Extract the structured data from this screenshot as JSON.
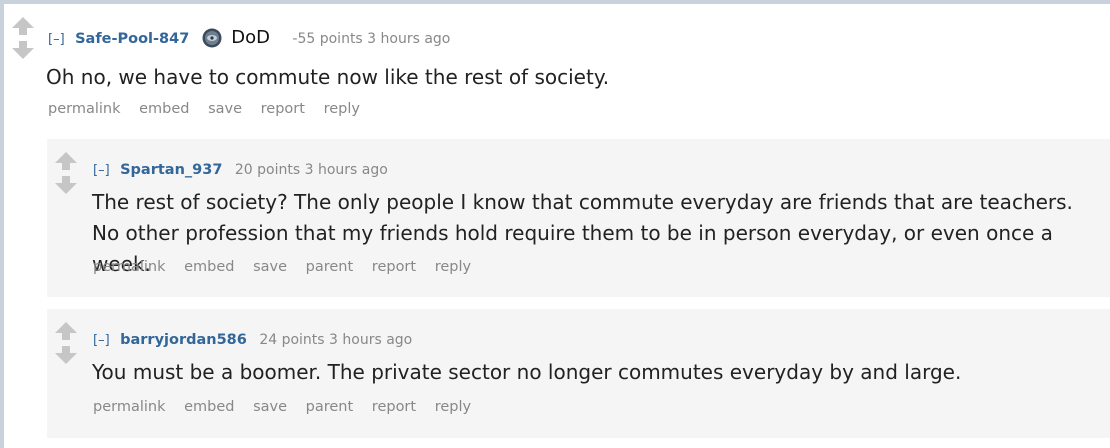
{
  "comments": [
    {
      "toggle": "[–]",
      "author": "Safe-Pool-847",
      "flair_icon": "dod-seal-icon",
      "flair": "DoD",
      "score_time": "-55 points 3 hours ago",
      "body": "Oh no, we have to commute now like the rest of society.",
      "actions": [
        "permalink",
        "embed",
        "save",
        "report",
        "reply"
      ]
    },
    {
      "toggle": "[–]",
      "author": "Spartan_937",
      "score_time": "20 points 3 hours ago",
      "body": "The rest of society? The only people I know that commute everyday are friends that are teachers. No other profession that my friends hold require them to be in person everyday, or even once a week.",
      "actions": [
        "permalink",
        "embed",
        "save",
        "parent",
        "report",
        "reply"
      ]
    },
    {
      "toggle": "[–]",
      "author": "barryjordan586",
      "score_time": "24 points 3 hours ago",
      "body": "You must be a boomer. The private sector no longer commutes everyday by and large.",
      "actions": [
        "permalink",
        "embed",
        "save",
        "parent",
        "report",
        "reply"
      ]
    }
  ],
  "colors": {
    "author": "#336699",
    "meta": "#888888",
    "child_bg": "#f5f5f6",
    "arrow": "#c6c6c6"
  }
}
